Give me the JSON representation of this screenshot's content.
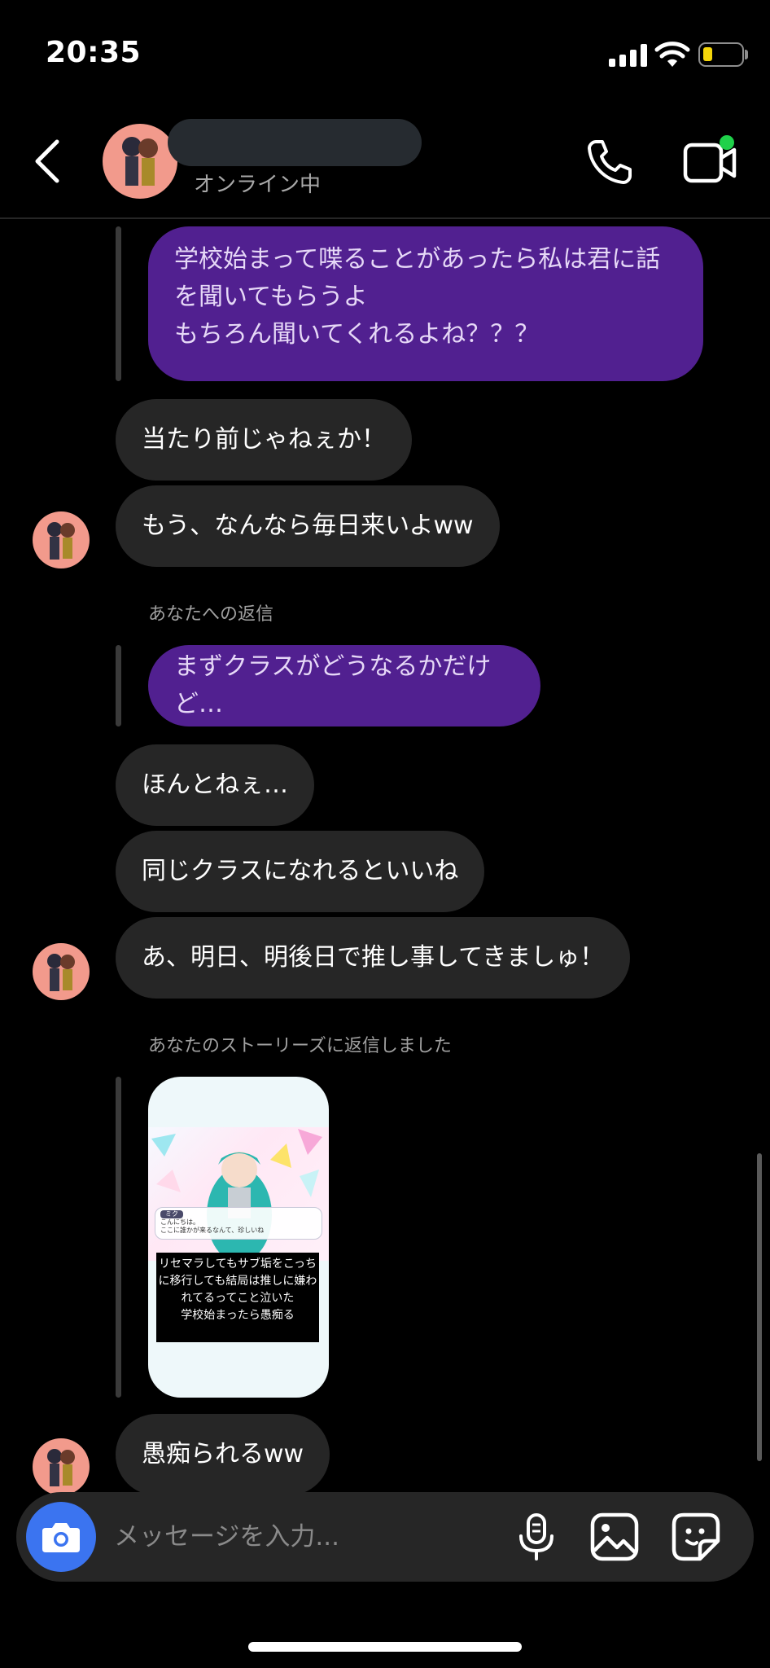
{
  "status_bar": {
    "time": "20:35",
    "battery_level": 0.25
  },
  "header": {
    "status_text": "オンライン中",
    "back_icon": "chevron-left-icon",
    "call_icon": "phone-icon",
    "video_icon": "video-call-icon",
    "online_color": "#1fd14a"
  },
  "colors": {
    "outgoing_bubble": "#512090",
    "incoming_bubble": "#262626",
    "camera_button": "#3b74f0"
  },
  "messages": [
    {
      "type": "outgoing_reply",
      "text": "学校始まって喋ることがあったら私は君に話を聞いてもらうよ\nもちろん聞いてくれるよね？？？"
    },
    {
      "type": "incoming",
      "text": "当たり前じゃねぇか！"
    },
    {
      "type": "incoming",
      "text": "もう、なんなら毎日来いよww"
    },
    {
      "type": "reply_label",
      "text": "あなたへの返信"
    },
    {
      "type": "outgoing_reply",
      "text": "まずクラスがどうなるかだけど…"
    },
    {
      "type": "incoming",
      "text": "ほんとねぇ…"
    },
    {
      "type": "incoming",
      "text": "同じクラスになれるといいね"
    },
    {
      "type": "incoming",
      "text": "あ、明日、明後日で推し事してきましゅ！"
    },
    {
      "type": "reply_label",
      "text": "あなたのストーリーズに返信しました"
    },
    {
      "type": "story_reply",
      "game_text_name": "ミク",
      "game_text": "こんにちは。\nここに誰かが来るなんて、珍しいね",
      "caption": "リセマラしてもサブ垢をこっちに移行しても結局は推しに嫌われてるってこと泣いた\n学校始まったら愚痴る"
    },
    {
      "type": "incoming",
      "text": "愚痴られるww"
    }
  ],
  "composer": {
    "placeholder": "メッセージを入力...",
    "camera_icon": "camera-icon",
    "mic_icon": "microphone-icon",
    "gallery_icon": "image-icon",
    "sticker_icon": "sticker-icon"
  }
}
